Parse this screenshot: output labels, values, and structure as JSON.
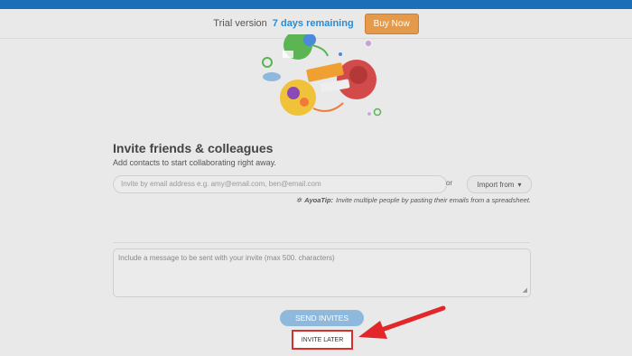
{
  "trial": {
    "prefix": "Trial version",
    "highlight": "7 days remaining",
    "buy_label": "Buy Now"
  },
  "invite": {
    "title": "Invite friends & colleagues",
    "subtitle": "Add contacts to start collaborating right away.",
    "email_placeholder": "Invite by email address e.g. amy@email.com, ben@email.com",
    "or_label": "or",
    "import_label": "Import from",
    "tip_label": "AyoaTip:",
    "tip_text": "Invite multiple people by pasting their emails from a spreadsheet.",
    "message_placeholder": "Include a message to be sent with your invite (max 500. characters)",
    "send_label": "SEND INVITES",
    "later_label": "INVITE LATER"
  },
  "colors": {
    "accent_blue": "#1a6fb8",
    "buy_orange": "#e49a4a",
    "highlight_red": "#d9302c"
  },
  "icons": [
    "globe-illustration",
    "lightbulb-icon",
    "chevron-down-icon",
    "resize-handle-icon",
    "red-arrow-annotation"
  ]
}
